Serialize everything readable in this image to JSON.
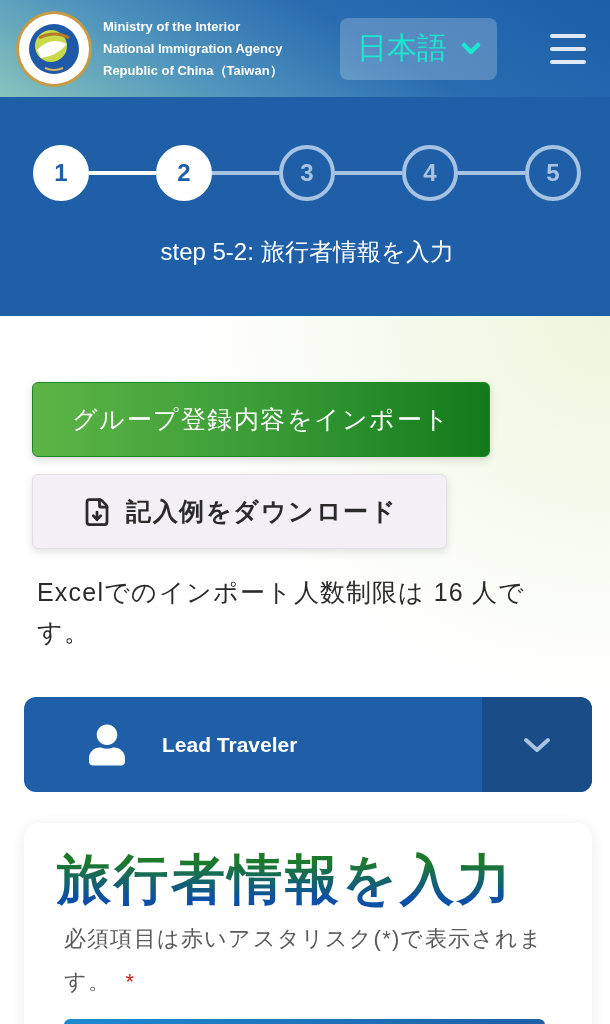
{
  "header": {
    "agency_lines": [
      "Ministry of the Interior",
      "National Immigration Agency",
      "Republic of China（Taiwan）"
    ],
    "language": "日本語"
  },
  "stepper": {
    "steps": [
      {
        "label": "1",
        "active": true
      },
      {
        "label": "2",
        "active": true
      },
      {
        "label": "3",
        "active": false
      },
      {
        "label": "4",
        "active": false
      },
      {
        "label": "5",
        "active": false
      }
    ],
    "caption": "step 5-2: 旅行者情報を入力"
  },
  "actions": {
    "import_button": "グループ登録内容をインポート",
    "sample_button": "記入例をダウンロード",
    "limit_note": "Excelでのインポート人数制限は 16 人です。"
  },
  "traveler_panel": {
    "title": "Lead Traveler",
    "expanded": false
  },
  "form_card": {
    "heading": "旅行者情報を入力",
    "required_note": "必須項目は赤いアスタリスク(*)で表示されます。",
    "required_mark": "*"
  }
}
